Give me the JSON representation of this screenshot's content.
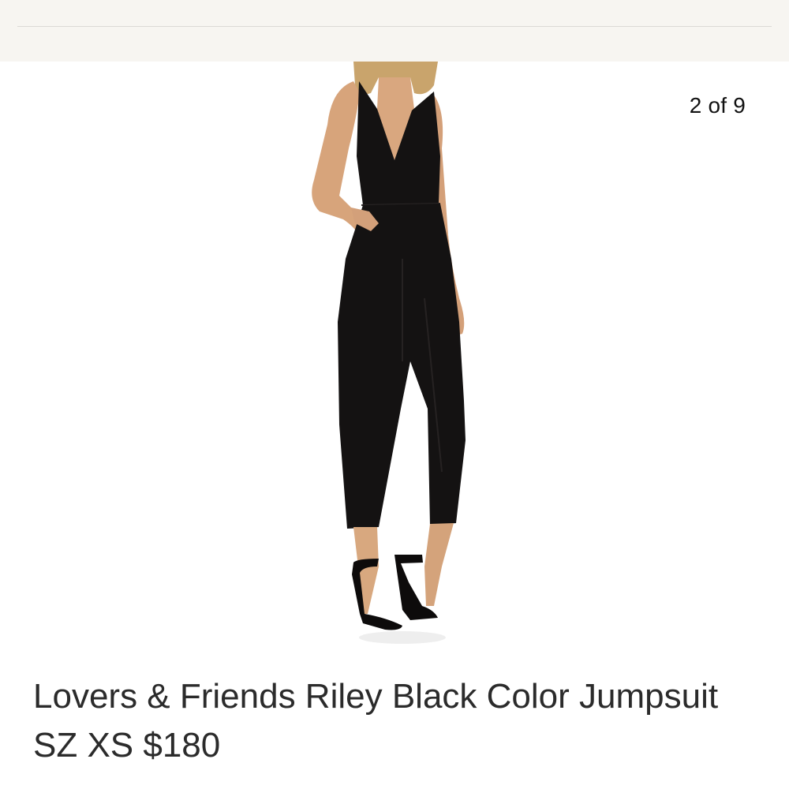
{
  "gallery": {
    "counter": "2 of 9",
    "image_description_icon": "product-photo-jumpsuit"
  },
  "listing": {
    "title": "Lovers & Friends Riley Black Color Jumpsuit SZ XS  $180"
  },
  "colors": {
    "top_bar": "#f7f5f1",
    "title_text": "#2b2b2b",
    "garment": "#141212"
  }
}
